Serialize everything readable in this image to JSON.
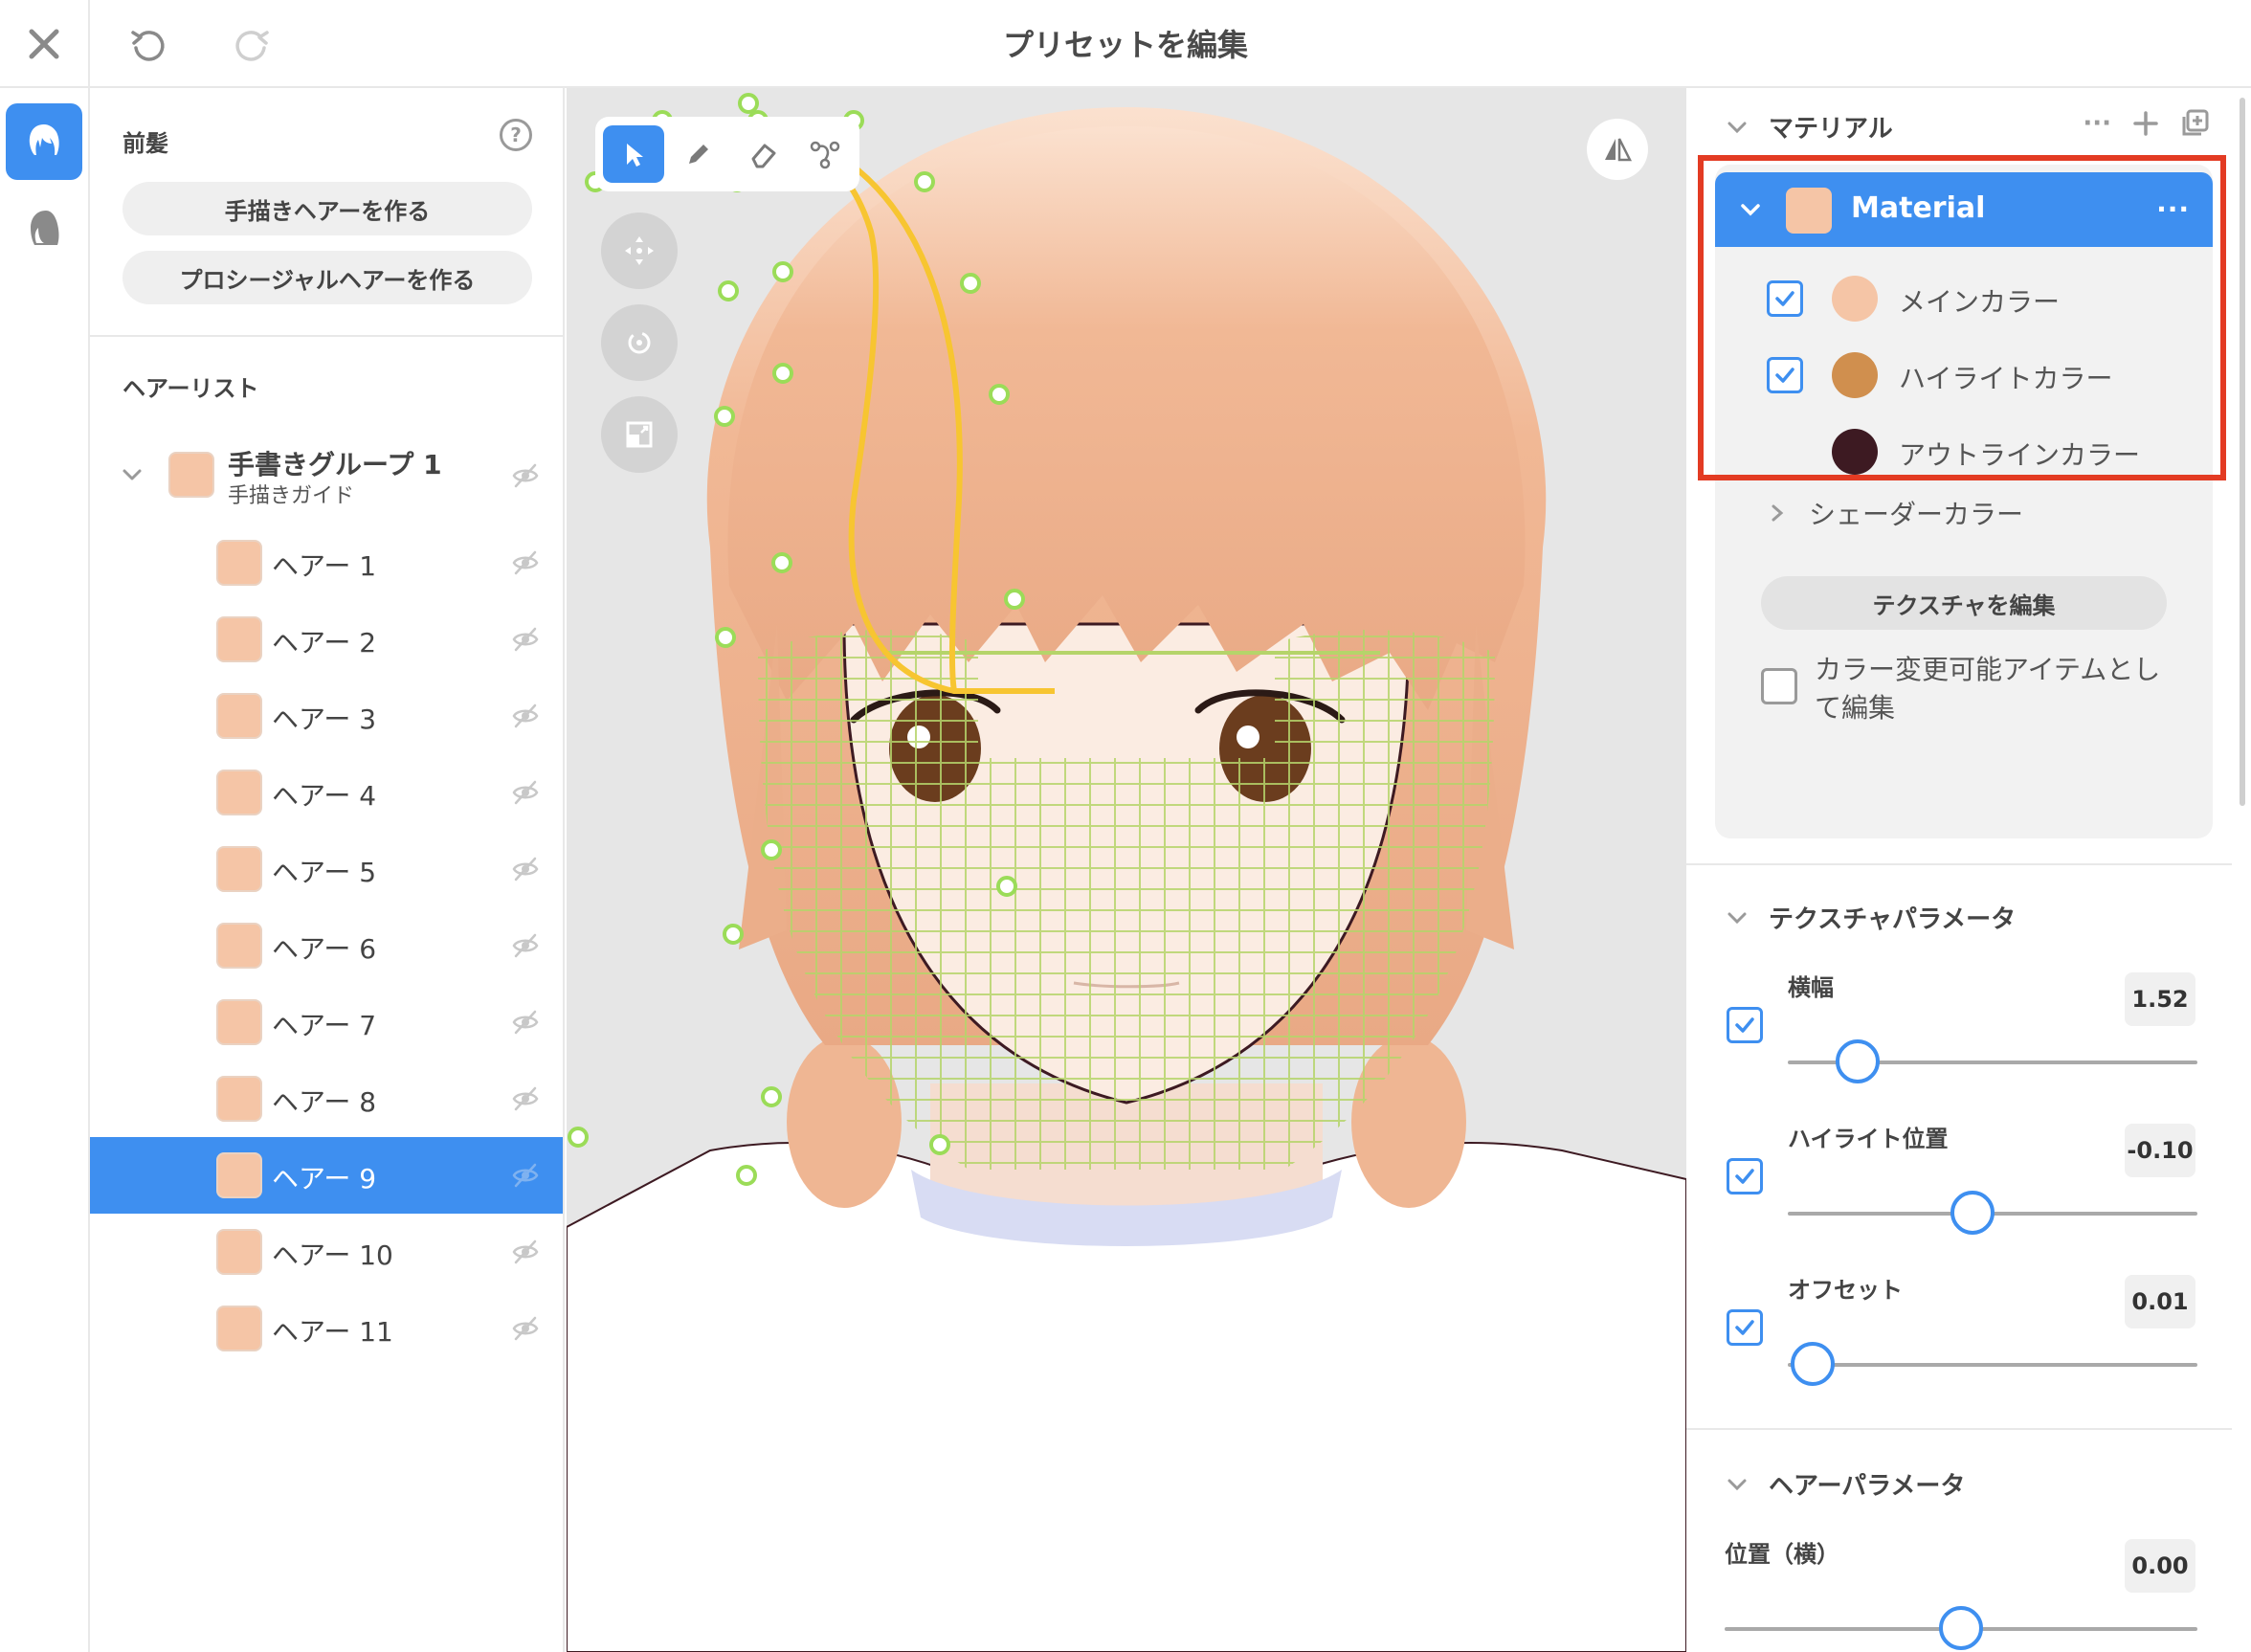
{
  "window": {
    "title": "プリセットを編集"
  },
  "left_panel": {
    "header": "前髪",
    "buttons": {
      "hand_drawn": "手描きヘアーを作る",
      "procedural": "プロシージャルヘアーを作る"
    },
    "list_title": "ヘアーリスト",
    "group": {
      "title": "手書きグループ 1",
      "subtitle": "手描きガイド"
    },
    "items": [
      {
        "label": "ヘアー 1"
      },
      {
        "label": "ヘアー 2"
      },
      {
        "label": "ヘアー 3"
      },
      {
        "label": "ヘアー 4"
      },
      {
        "label": "ヘアー 5"
      },
      {
        "label": "ヘアー 6"
      },
      {
        "label": "ヘアー 7"
      },
      {
        "label": "ヘアー 8"
      },
      {
        "label": "ヘアー 9"
      },
      {
        "label": "ヘアー 10"
      },
      {
        "label": "ヘアー 11"
      }
    ],
    "selected_index": 8
  },
  "right_panel": {
    "material_section": "マテリアル",
    "material": {
      "name": "Material",
      "more": "···",
      "colors": [
        {
          "label": "メインカラー",
          "color": "#f5c5a6",
          "checked": true
        },
        {
          "label": "ハイライトカラー",
          "color": "#d08f4e",
          "checked": true
        },
        {
          "label": "アウトラインカラー",
          "color": "#3d1a22",
          "checked": false
        }
      ],
      "shader_color": "シェーダーカラー",
      "edit_texture": "テクスチャを編集",
      "editable_item": "カラー変更可能アイテムとして編集"
    },
    "texture_section": "テクスチャパラメータ",
    "texture_params": [
      {
        "label": "横幅",
        "value": "1.52",
        "checked": true,
        "level": 0.17
      },
      {
        "label": "ハイライト位置",
        "value": "-0.10",
        "checked": true,
        "level": 0.45
      },
      {
        "label": "オフセット",
        "value": "0.01",
        "checked": true,
        "level": 0.06
      }
    ],
    "hair_section": "ヘアーパラメータ",
    "hair_params": [
      {
        "label": "位置（横）",
        "value": "0.00",
        "level": 0.5
      }
    ]
  },
  "colors": {
    "accent": "#3e8ff0",
    "hair_swatch": "#f5c5a6",
    "highlight_frame": "#e33b23",
    "guide_curve": "#f7c531",
    "mesh": "#b5d46a"
  },
  "icons": {
    "close": "close-icon",
    "undo": "undo-icon",
    "redo": "redo-icon",
    "front_hair_mode": "front-hair-icon",
    "back_hair_mode": "back-hair-icon",
    "help": "help-icon",
    "visibility": "eye-off-icon",
    "select_tool": "cursor-icon",
    "pen_tool": "pencil-icon",
    "eraser_tool": "eraser-icon",
    "curve_tool": "curve-path-icon",
    "move": "move-icon",
    "rotate": "rotate-icon",
    "scale": "scale-icon",
    "mirror": "mirror-icon"
  }
}
